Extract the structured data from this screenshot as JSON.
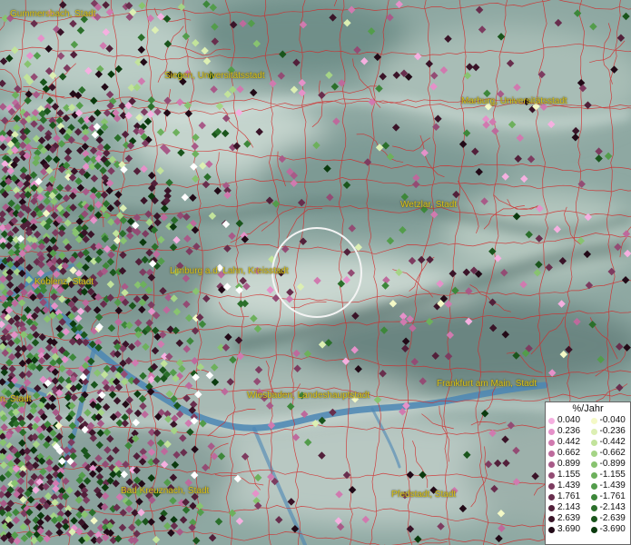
{
  "legend": {
    "title": "%/Jahr",
    "rows": [
      {
        "pos": "0.040",
        "pos_color": "#f5b0e0",
        "neg": "-0.040",
        "neg_color": "#f4f9c6"
      },
      {
        "pos": "0.236",
        "pos_color": "#e591c9",
        "neg": "-0.236",
        "neg_color": "#dcefb3"
      },
      {
        "pos": "0.442",
        "pos_color": "#d07aaf",
        "neg": "-0.442",
        "neg_color": "#c2e39b"
      },
      {
        "pos": "0.662",
        "pos_color": "#bd6a9c",
        "neg": "-0.662",
        "neg_color": "#a5d486"
      },
      {
        "pos": "0.899",
        "pos_color": "#a85a88",
        "neg": "-0.899",
        "neg_color": "#88c370"
      },
      {
        "pos": "1.155",
        "pos_color": "#934c74",
        "neg": "-1.155",
        "neg_color": "#6db05c"
      },
      {
        "pos": "1.439",
        "pos_color": "#7d3c60",
        "neg": "-1.439",
        "neg_color": "#539c4b"
      },
      {
        "pos": "1.761",
        "pos_color": "#682e4d",
        "neg": "-1.761",
        "neg_color": "#3d873a"
      },
      {
        "pos": "2.143",
        "pos_color": "#52203a",
        "neg": "-2.143",
        "neg_color": "#2b6f2b"
      },
      {
        "pos": "2.639",
        "pos_color": "#3a1428",
        "neg": "-2.639",
        "neg_color": "#1a551c"
      },
      {
        "pos": "3.690",
        "pos_color": "#220a17",
        "neg": "-3.690",
        "neg_color": "#0b3a0e"
      }
    ]
  },
  "cities": [
    {
      "name": "Gummersbach, Stadt"
    },
    {
      "name": "Siegen, Universitätsstadt"
    },
    {
      "name": "Marburg, Universitätsstadt"
    },
    {
      "name": "Wetzlar, Stadt"
    },
    {
      "name": "Limburg a.d. Lahn, Kreisstadt"
    },
    {
      "name": "Koblenz, Stadt"
    },
    {
      "name": "n, Stadt"
    },
    {
      "name": "Wiesbaden, Landeshauptstadt"
    },
    {
      "name": "Frankfurt am Main, Stadt"
    },
    {
      "name": "Bad Kreuznach, Stadt"
    },
    {
      "name": "Pfedstadt, Stadt"
    }
  ],
  "colors": {
    "terrain": "#8fa9a4",
    "river": "#4b86b4",
    "boundaries": "#d22a2a",
    "label": "#d9c21a",
    "selection_circle": "#f4f4f4"
  }
}
